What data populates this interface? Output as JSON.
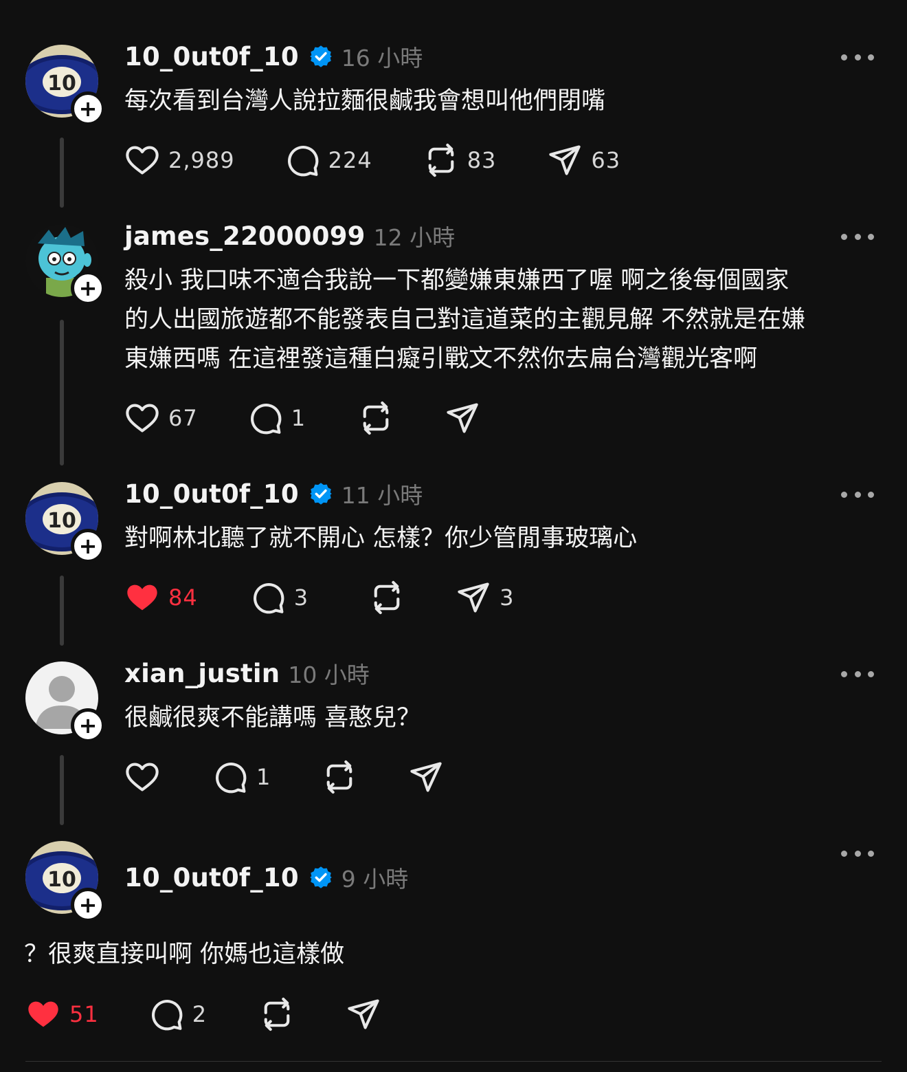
{
  "colors": {
    "background": "#101010",
    "liked": "#ff3040",
    "verified": "#0095f6",
    "muted": "#7a7a7a"
  },
  "posts": [
    {
      "username": "10_0ut0f_10",
      "verified": true,
      "time": "16 小時",
      "text": "每次看到台灣人說拉麵很鹹我會想叫他們閉嘴",
      "avatar": "billiard-ball-10",
      "likes": "2,989",
      "liked": false,
      "replies": "224",
      "reposts": "83",
      "shares": "63"
    },
    {
      "username": "james_22000099",
      "verified": false,
      "time": "12 小時",
      "text": "殺小 我口味不適合我說一下都變嫌東嫌西了喔 啊之後每個國家\n的人出國旅遊都不能發表自己對這道菜的主觀見解 不然就是在嫌\n東嫌西嗎 在這裡發這種白癡引戰文不然你去扁台灣觀光客啊",
      "avatar": "cartoon-character",
      "likes": "67",
      "liked": false,
      "replies": "1",
      "reposts": "",
      "shares": ""
    },
    {
      "username": "10_0ut0f_10",
      "verified": true,
      "time": "11 小時",
      "text": "對啊林北聽了就不開心 怎樣？你少管閒事玻璃心",
      "avatar": "billiard-ball-10",
      "likes": "84",
      "liked": true,
      "replies": "3",
      "reposts": "",
      "shares": "3"
    },
    {
      "username": "xian_justin",
      "verified": false,
      "time": "10 小時",
      "text": "很鹹很爽不能講嗎 喜憨兒？",
      "avatar": "default-user",
      "likes": "",
      "liked": false,
      "replies": "1",
      "reposts": "",
      "shares": ""
    },
    {
      "username": "10_0ut0f_10",
      "verified": true,
      "time": "9 小時",
      "text": "？很爽直接叫啊 你媽也這樣做",
      "avatar": "billiard-ball-10",
      "likes": "51",
      "liked": true,
      "replies": "2",
      "reposts": "",
      "shares": ""
    }
  ],
  "avatar_labels": {
    "ball": "10"
  }
}
